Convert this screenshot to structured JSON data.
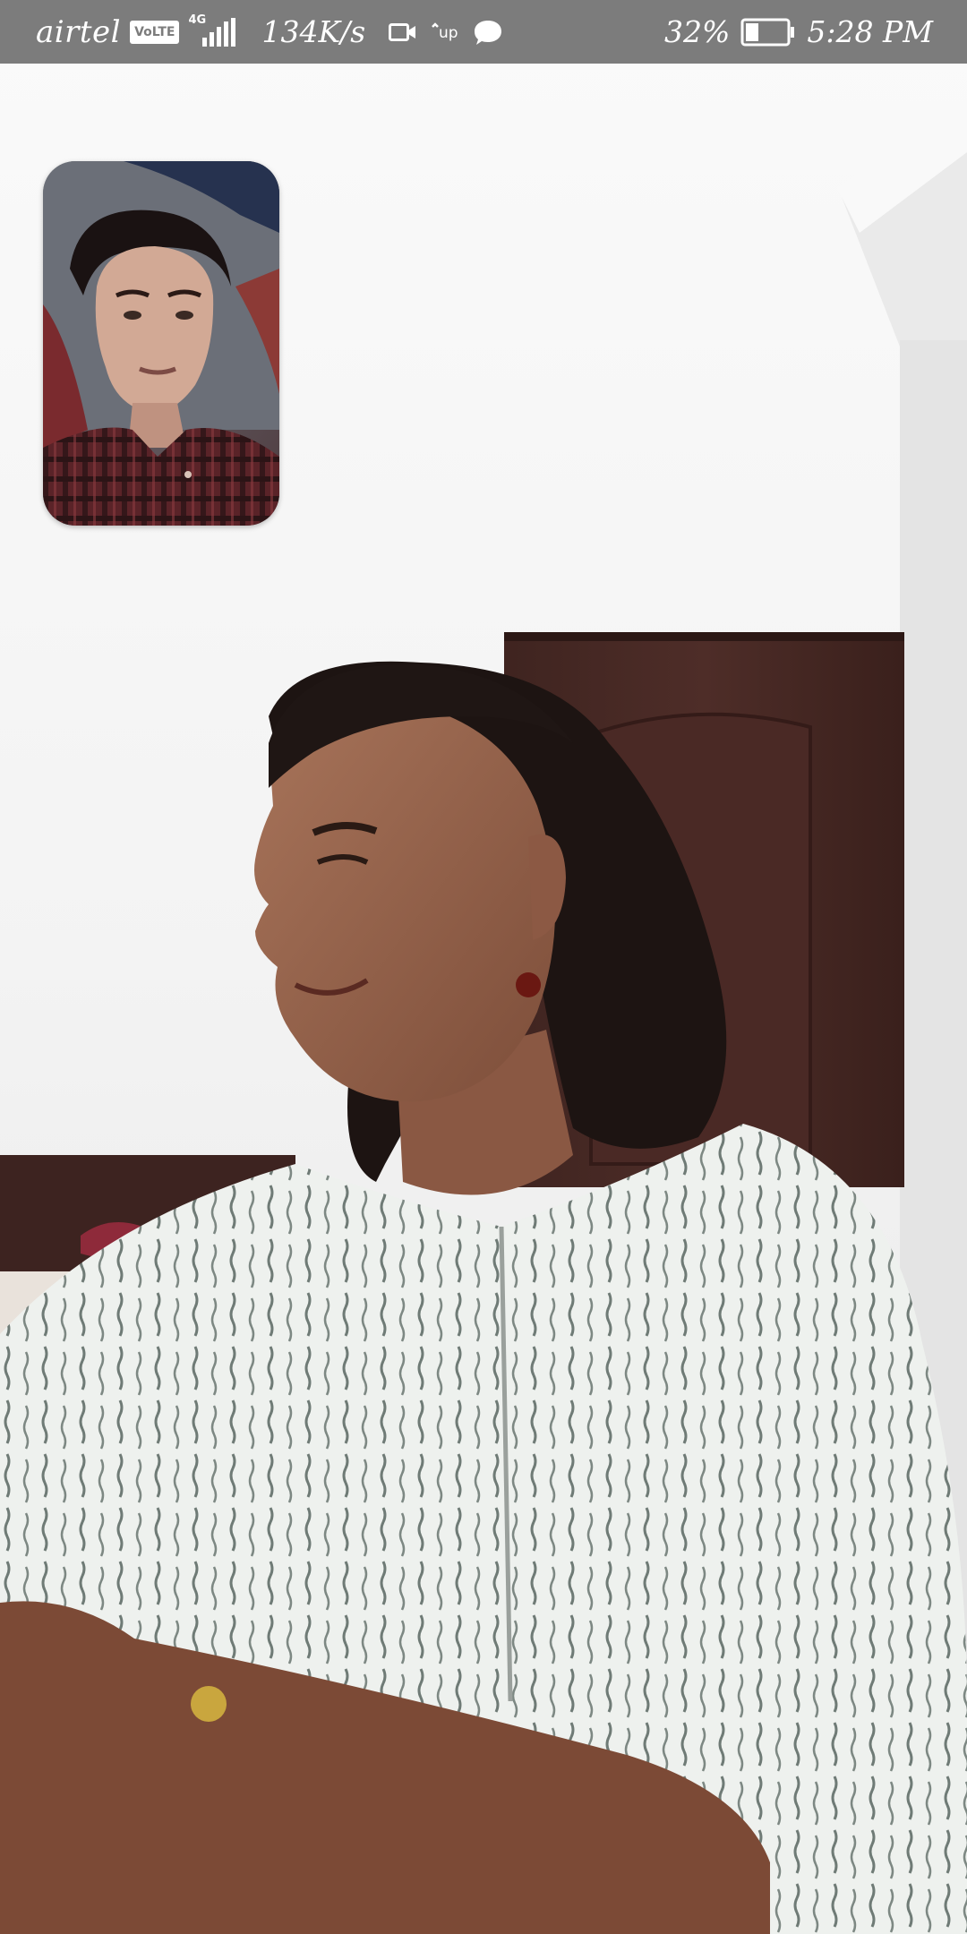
{
  "status_bar": {
    "carrier": "airtel",
    "volte_badge": "VoLTE",
    "network_type": "4G",
    "network_speed": "134K/s",
    "battery_percent": "32%",
    "battery_level": 0.32,
    "time": "5:28 PM",
    "icons": [
      "signal-icon",
      "video-camera-icon",
      "up-icon",
      "chat-bubble-icon",
      "battery-icon"
    ]
  },
  "call": {
    "remote_video": "remote-video-feed",
    "self_preview": "self-preview-feed"
  },
  "colors": {
    "status_bar_bg": "#7c7c7c",
    "status_text": "#ffffff",
    "wall": "#f6f6f6",
    "door": "#4a2a26"
  }
}
